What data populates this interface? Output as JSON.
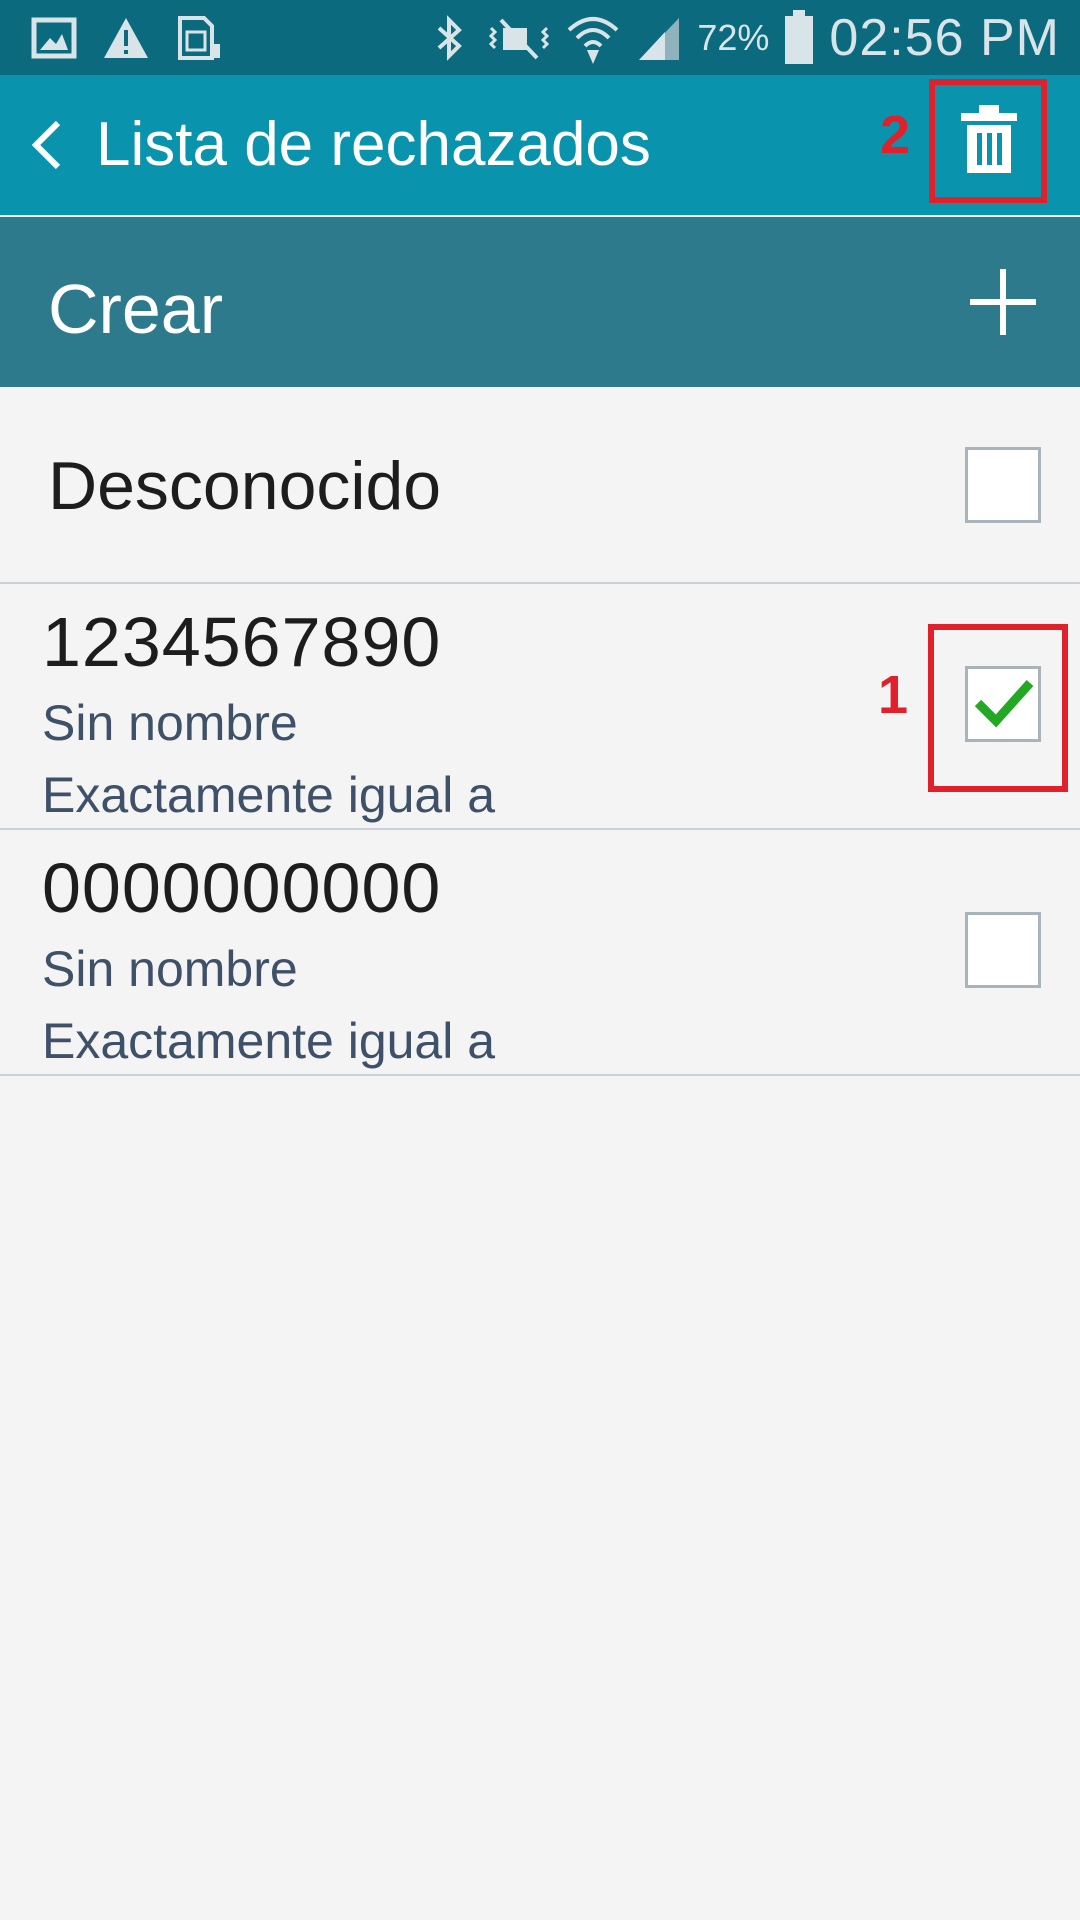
{
  "status_bar": {
    "battery_percent": "72%",
    "time": "02:56 PM",
    "icons": [
      "gallery-icon",
      "warning-icon",
      "sim-icon",
      "bluetooth-icon",
      "vibrate-mute-icon",
      "wifi-icon",
      "signal-icon",
      "battery-icon"
    ]
  },
  "action_bar": {
    "title": "Lista de rechazados",
    "back_icon": "chevron-left-icon",
    "delete_icon": "trash-icon"
  },
  "create_bar": {
    "label": "Crear",
    "icon": "plus-icon"
  },
  "list": {
    "unknown_label": "Desconocido",
    "unknown_checked": false,
    "items": [
      {
        "number": "1234567890",
        "name": "Sin nombre",
        "match": "Exactamente igual a",
        "checked": true
      },
      {
        "number": "0000000000",
        "name": "Sin nombre",
        "match": "Exactamente igual a",
        "checked": false
      }
    ]
  },
  "annotations": {
    "label_1": "1",
    "label_2": "2",
    "color": "#e0202a"
  },
  "colors": {
    "status_bar": "#0b6a7e",
    "action_bar": "#0a93ad",
    "create_bar": "#2c7a8b",
    "check": "#22a822"
  }
}
